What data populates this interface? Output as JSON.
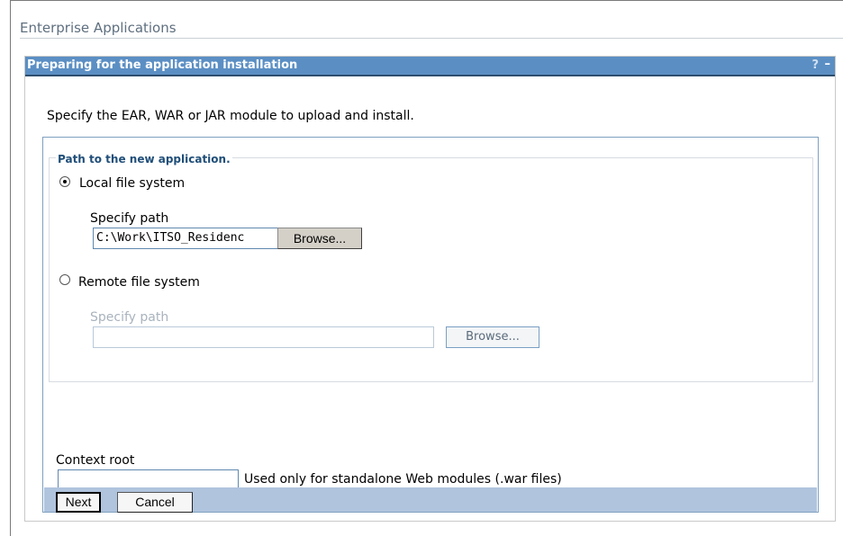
{
  "page": {
    "title": "Enterprise Applications"
  },
  "portlet": {
    "title": "Preparing for the application installation",
    "help_glyph": "?",
    "minimize_glyph": "–"
  },
  "form": {
    "instruction": "Specify the EAR, WAR or JAR module to upload and install.",
    "path_legend": "Path to the new application.",
    "local": {
      "label": "Local file system",
      "selected": true,
      "specify_label": "Specify path",
      "path_value": "C:\\Work\\ITSO_Residenc",
      "browse_label": "Browse..."
    },
    "remote": {
      "label": "Remote file system",
      "selected": false,
      "specify_label": "Specify path",
      "path_value": "",
      "browse_label": "Browse..."
    },
    "context_root": {
      "label": "Context root",
      "value": "",
      "hint": "Used only for standalone Web modules (.war files)"
    }
  },
  "buttons": {
    "next": "Next",
    "cancel": "Cancel"
  },
  "colors": {
    "header_bg": "#5b8fc4",
    "button_bar_bg": "#b0c4de",
    "legend_text": "#1f4e79"
  }
}
